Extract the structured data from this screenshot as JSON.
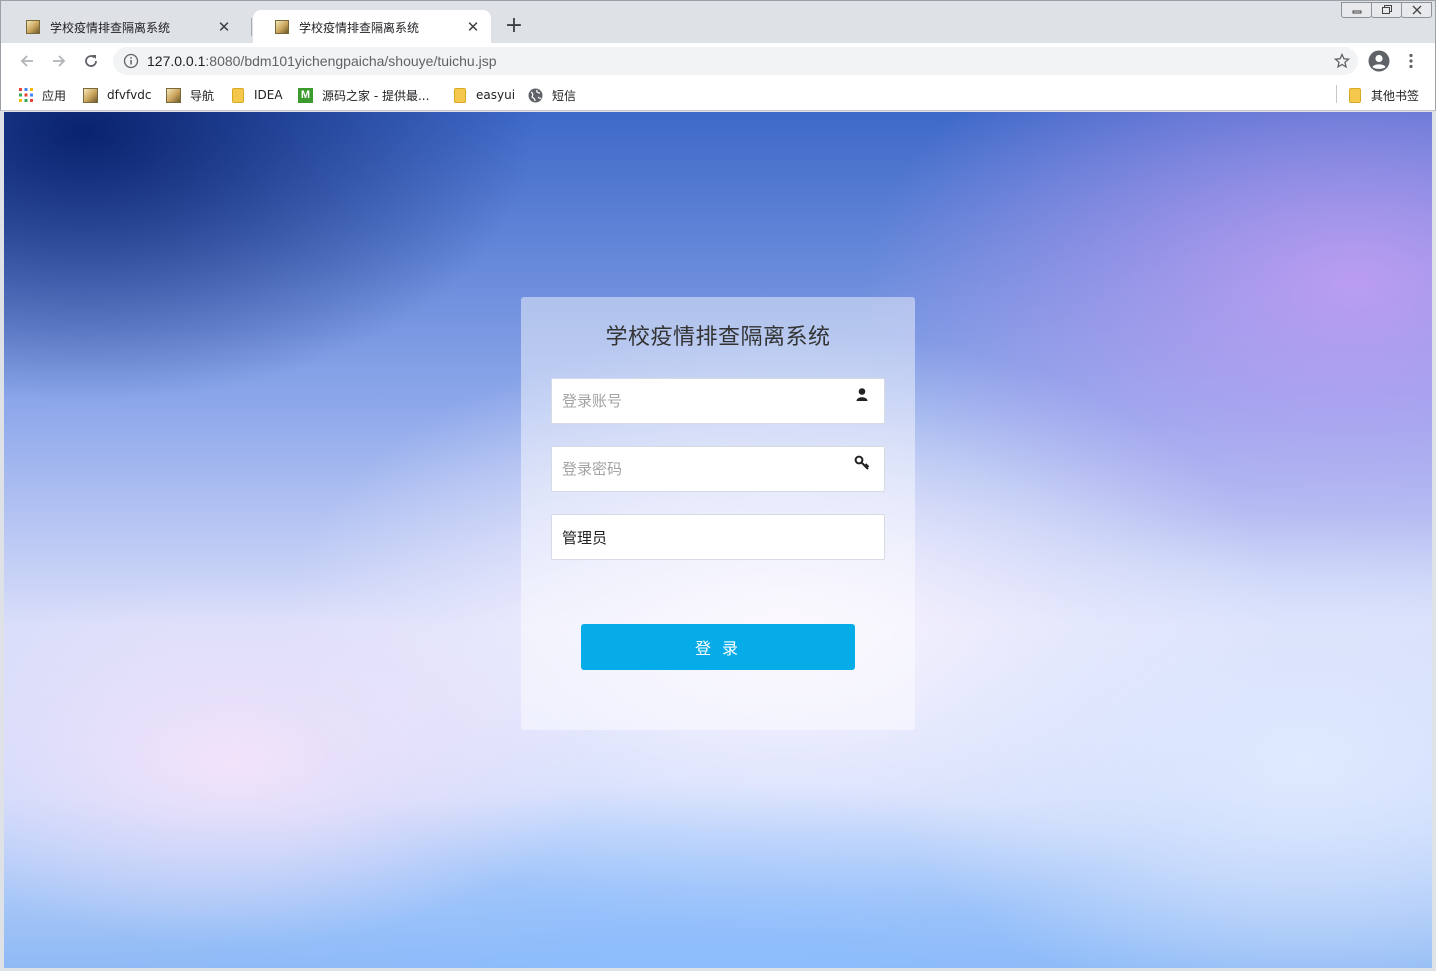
{
  "browser": {
    "tabs": [
      {
        "title": "学校疫情排查隔离系统",
        "active": false
      },
      {
        "title": "学校疫情排查隔离系统",
        "active": true
      }
    ],
    "tab_close_glyph": "✕",
    "new_tab_glyph": "+",
    "url_host": "127.0.0.1",
    "url_rest": ":8080/bdm101yichengpaicha/shouye/tuichu.jsp",
    "bookmarks": [
      {
        "label": "应用",
        "icon": "apps-grid-icon"
      },
      {
        "label": "dfvfvdc",
        "icon": "image-favicon-icon"
      },
      {
        "label": "导航",
        "icon": "image-favicon-icon"
      },
      {
        "label": "IDEA",
        "icon": "folder-icon"
      },
      {
        "label": "源码之家 - 提供最...",
        "icon": "m-favicon-icon",
        "icon_text": "M"
      },
      {
        "label": "easyui",
        "icon": "folder-icon"
      },
      {
        "label": "短信",
        "icon": "globe-icon"
      }
    ],
    "other_bookmarks": "其他书签"
  },
  "login": {
    "title": "学校疫情排查隔离系统",
    "username_placeholder": "登录账号",
    "password_placeholder": "登录密码",
    "role_value": "管理员",
    "submit_label": "登 录"
  },
  "colors": {
    "button": "#06ace7",
    "tab_strip": "#dee1e6"
  }
}
